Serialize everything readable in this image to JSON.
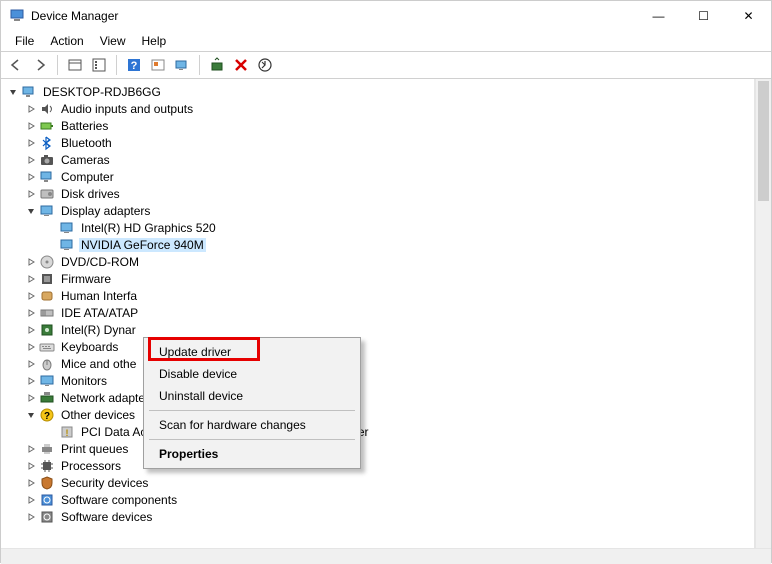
{
  "window": {
    "title": "Device Manager",
    "controls": {
      "min": "—",
      "max": "☐",
      "close": "✕"
    }
  },
  "menubar": [
    "File",
    "Action",
    "View",
    "Help"
  ],
  "toolbar_icons": [
    "back",
    "forward",
    "show-hide",
    "properties",
    "help",
    "action-center",
    "update",
    "scan",
    "uninstall",
    "hardware-changes"
  ],
  "root": {
    "label": "DESKTOP-RDJB6GG"
  },
  "tree": [
    {
      "icon": "audio",
      "label": "Audio inputs and outputs",
      "expander": "right"
    },
    {
      "icon": "battery",
      "label": "Batteries",
      "expander": "right"
    },
    {
      "icon": "bluetooth",
      "label": "Bluetooth",
      "expander": "right"
    },
    {
      "icon": "camera",
      "label": "Cameras",
      "expander": "right"
    },
    {
      "icon": "computer",
      "label": "Computer",
      "expander": "right"
    },
    {
      "icon": "disk",
      "label": "Disk drives",
      "expander": "right"
    },
    {
      "icon": "display",
      "label": "Display adapters",
      "expander": "down",
      "children": [
        {
          "icon": "display",
          "label": "Intel(R) HD Graphics 520"
        },
        {
          "icon": "display",
          "label": "NVIDIA GeForce 940M",
          "selected": true
        }
      ]
    },
    {
      "icon": "dvd",
      "label": "DVD/CD-ROM",
      "expander": "right"
    },
    {
      "icon": "firmware",
      "label": "Firmware",
      "expander": "right"
    },
    {
      "icon": "hid",
      "label": "Human Interfa",
      "expander": "right"
    },
    {
      "icon": "ide",
      "label": "IDE ATA/ATAP",
      "expander": "right"
    },
    {
      "icon": "intel",
      "label": "Intel(R) Dynar",
      "expander": "right"
    },
    {
      "icon": "keyboard",
      "label": "Keyboards",
      "expander": "right"
    },
    {
      "icon": "mouse",
      "label": "Mice and othe",
      "expander": "right"
    },
    {
      "icon": "monitor",
      "label": "Monitors",
      "expander": "right"
    },
    {
      "icon": "network",
      "label": "Network adapters",
      "expander": "right"
    },
    {
      "icon": "other",
      "label": "Other devices",
      "expander": "down",
      "children": [
        {
          "icon": "unknown",
          "label": "PCI Data Acquisition and Signal Processing Controller"
        }
      ]
    },
    {
      "icon": "printer",
      "label": "Print queues",
      "expander": "right"
    },
    {
      "icon": "cpu",
      "label": "Processors",
      "expander": "right"
    },
    {
      "icon": "security",
      "label": "Security devices",
      "expander": "right"
    },
    {
      "icon": "software",
      "label": "Software components",
      "expander": "right"
    },
    {
      "icon": "software2",
      "label": "Software devices",
      "expander": "right"
    }
  ],
  "context_menu": {
    "items": [
      {
        "label": "Update driver",
        "highlight": true
      },
      {
        "label": "Disable device"
      },
      {
        "label": "Uninstall device"
      },
      {
        "sep": true
      },
      {
        "label": "Scan for hardware changes"
      },
      {
        "sep": true
      },
      {
        "label": "Properties",
        "bold": true
      }
    ]
  }
}
